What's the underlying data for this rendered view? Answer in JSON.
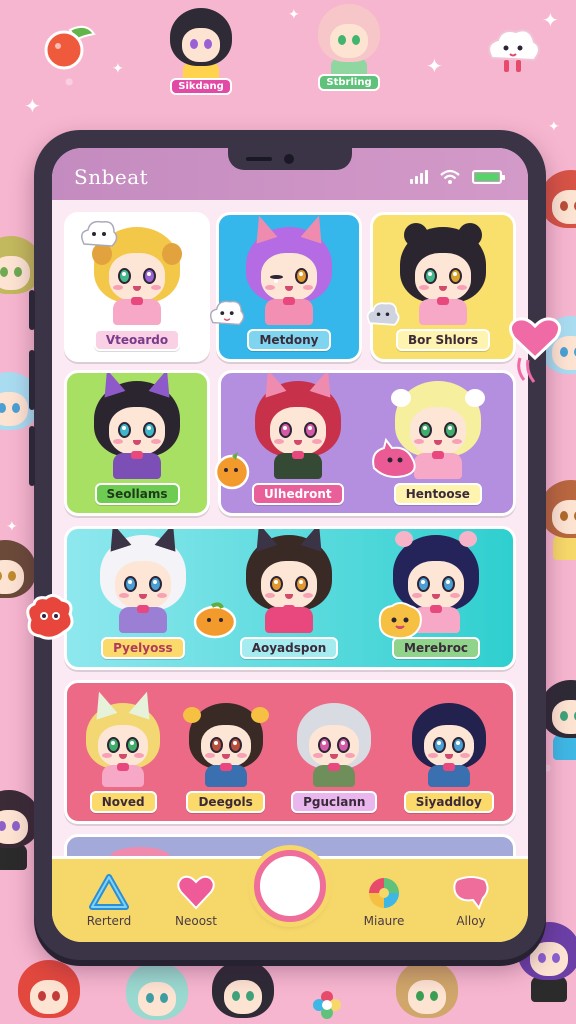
{
  "app": {
    "title": "Snbeat"
  },
  "background": {
    "badges": [
      "Sikdang",
      "Stbrling"
    ]
  },
  "cards": [
    {
      "label": "Vteoardo",
      "label_color": "#f9d0e4",
      "bg": "#ffffff"
    },
    {
      "label": "Metdony",
      "label_color": "#7fd4ef",
      "bg": "#35b7ec"
    },
    {
      "label": "Bor Shlors",
      "label_color": "#fff3b0",
      "bg": "#f9df6b"
    },
    {
      "label": "Seollams",
      "label_color": "#6fcc52",
      "bg": "#a8e063"
    },
    {
      "label": "Ulhedront",
      "label_color": "#e95f9a",
      "bg": "#b48fe0"
    },
    {
      "label": "Hentoose",
      "label_color": "#fff3b0",
      "bg": "#b48fe0"
    },
    {
      "label": "Pyelyoss",
      "label_color": "#fbd96a",
      "bg": "#7fe1e7"
    },
    {
      "label": "Aoyadspon",
      "label_color": "#a5ecf0",
      "bg": "#2fcfcf"
    },
    {
      "label": "Merebroc",
      "label_color": "#8fd48a",
      "bg": "#2fcfcf"
    },
    {
      "label": "Noved",
      "label_color": "#fbd96a",
      "bg": "#ec6a86"
    },
    {
      "label": "Deegols",
      "label_color": "#fbd96a",
      "bg": "#ec6a86"
    },
    {
      "label": "Pguclann",
      "label_color": "#e9b7ee",
      "bg": "#ec6a86"
    },
    {
      "label": "Siyaddloy",
      "label_color": "#fbd96a",
      "bg": "#ec6a86"
    }
  ],
  "nav": {
    "items": [
      {
        "label": "Rerterd",
        "icon": "triangle-icon"
      },
      {
        "label": "Neoost",
        "icon": "heart-icon"
      },
      {
        "label": "Miaure",
        "icon": "palette-icon"
      },
      {
        "label": "Alloy",
        "icon": "speech-bubble-icon"
      }
    ],
    "capture_icon": "capture-button",
    "accent": "#ef6d9a"
  }
}
